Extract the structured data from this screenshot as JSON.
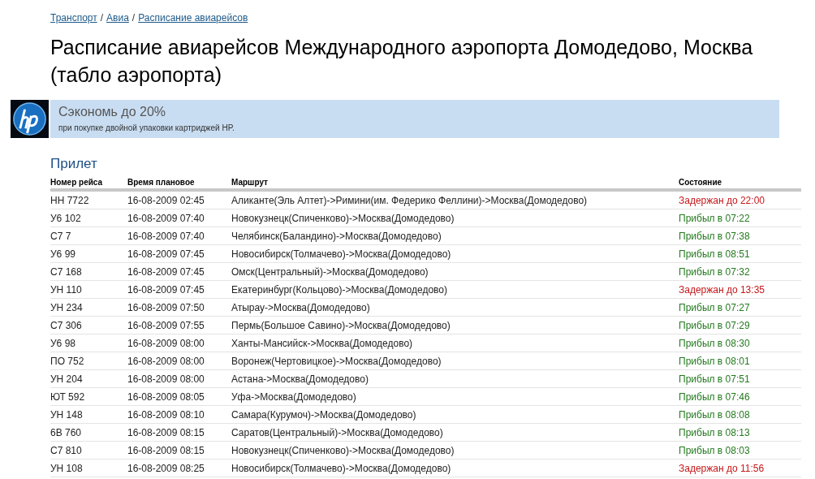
{
  "breadcrumb": [
    {
      "label": "Транспорт",
      "link": true
    },
    {
      "label": "/",
      "link": false
    },
    {
      "label": "Авиа",
      "link": true
    },
    {
      "label": "/",
      "link": false
    },
    {
      "label": "Расписание авиарейсов",
      "link": true
    }
  ],
  "title": "Расписание авиарейсов Международного аэропорта Домодедово, Москва (табло аэропорта)",
  "banner": {
    "headline": "Сэкономь до 20%",
    "text": "при покупке двойной упаковки картриджей HP."
  },
  "section": "Прилет",
  "table": {
    "columns": [
      "Номер рейса",
      "Время плановое",
      "Маршрут",
      "Состояние"
    ],
    "rows": [
      {
        "flight": "НН 7722",
        "time": "16-08-2009 02:45",
        "route": "Аликанте(Эль Алтет)->Римини(им. Федерико Феллини)->Москва(Домодедово)",
        "status": "Задержан до 22:00",
        "kind": "delayed"
      },
      {
        "flight": "У6 102",
        "time": "16-08-2009 07:40",
        "route": "Новокузнецк(Спиченково)->Москва(Домодедово)",
        "status": "Прибыл в 07:22",
        "kind": "arrived"
      },
      {
        "flight": "С7 7",
        "time": "16-08-2009 07:40",
        "route": "Челябинск(Баландино)->Москва(Домодедово)",
        "status": "Прибыл в 07:38",
        "kind": "arrived"
      },
      {
        "flight": "У6 99",
        "time": "16-08-2009 07:45",
        "route": "Новосибирск(Толмачево)->Москва(Домодедово)",
        "status": "Прибыл в 08:51",
        "kind": "arrived"
      },
      {
        "flight": "С7 168",
        "time": "16-08-2009 07:45",
        "route": "Омск(Центральный)->Москва(Домодедово)",
        "status": "Прибыл в 07:32",
        "kind": "arrived"
      },
      {
        "flight": "УН 110",
        "time": "16-08-2009 07:45",
        "route": "Екатеринбург(Кольцово)->Москва(Домодедово)",
        "status": "Задержан до 13:35",
        "kind": "delayed"
      },
      {
        "flight": "УН 234",
        "time": "16-08-2009 07:50",
        "route": "Атырау->Москва(Домодедово)",
        "status": "Прибыл в 07:27",
        "kind": "arrived"
      },
      {
        "flight": "С7 306",
        "time": "16-08-2009 07:55",
        "route": "Пермь(Большое Савино)->Москва(Домодедово)",
        "status": "Прибыл в 07:29",
        "kind": "arrived"
      },
      {
        "flight": "У6 98",
        "time": "16-08-2009 08:00",
        "route": "Ханты-Мансийск->Москва(Домодедово)",
        "status": "Прибыл в 08:30",
        "kind": "arrived"
      },
      {
        "flight": "ПО 752",
        "time": "16-08-2009 08:00",
        "route": "Воронеж(Чертовицкое)->Москва(Домодедово)",
        "status": "Прибыл в 08:01",
        "kind": "arrived"
      },
      {
        "flight": "УН 204",
        "time": "16-08-2009 08:00",
        "route": "Астана->Москва(Домодедово)",
        "status": "Прибыл в 07:51",
        "kind": "arrived"
      },
      {
        "flight": "ЮТ 592",
        "time": "16-08-2009 08:05",
        "route": "Уфа->Москва(Домодедово)",
        "status": "Прибыл в 07:46",
        "kind": "arrived"
      },
      {
        "flight": "УН 148",
        "time": "16-08-2009 08:10",
        "route": "Самара(Курумоч)->Москва(Домодедово)",
        "status": "Прибыл в 08:08",
        "kind": "arrived"
      },
      {
        "flight": "6В 760",
        "time": "16-08-2009 08:15",
        "route": "Саратов(Центральный)->Москва(Домодедово)",
        "status": "Прибыл в 08:13",
        "kind": "arrived"
      },
      {
        "flight": "С7 810",
        "time": "16-08-2009 08:15",
        "route": "Новокузнецк(Спиченково)->Москва(Домодедово)",
        "status": "Прибыл в 08:03",
        "kind": "arrived"
      },
      {
        "flight": "УН 108",
        "time": "16-08-2009 08:25",
        "route": "Новосибирск(Толмачево)->Москва(Домодедово)",
        "status": "Задержан до 11:56",
        "kind": "delayed"
      }
    ]
  }
}
